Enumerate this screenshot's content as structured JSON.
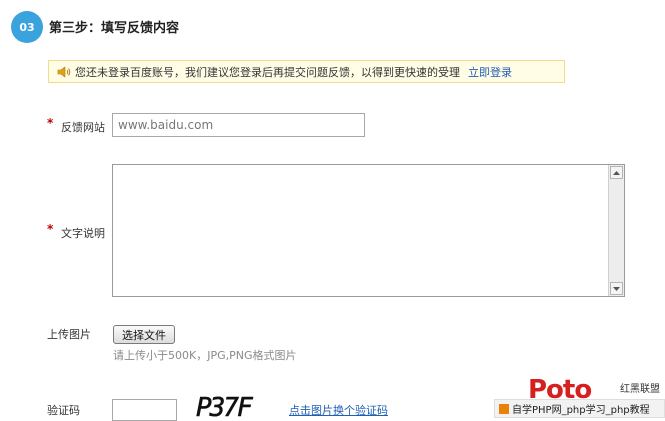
{
  "step": {
    "number": "03",
    "title": "第三步：填写反馈内容"
  },
  "notice": {
    "icon": "speaker-icon",
    "text": "您还未登录百度账号，我们建议您登录后再提交问题反馈，以得到更快速的受理",
    "link": "立即登录"
  },
  "form": {
    "required_mark": "*",
    "site": {
      "label": "反馈网站",
      "value": "www.baidu.com"
    },
    "desc": {
      "label": "文字说明",
      "value": ""
    },
    "upload": {
      "label": "上传图片",
      "button": "选择文件",
      "hint": "请上传小于500K，JPG,PNG格式图片"
    },
    "captcha": {
      "label": "验证码",
      "value": "",
      "image_text": "P37F",
      "refresh_link": "点击图片换个验证码"
    }
  },
  "watermark": {
    "logo_text": "Poto",
    "brand": "红黑联盟",
    "bar_text": "自学PHP网_php学习_php教程"
  },
  "colors": {
    "step_circle": "#3aa3dd",
    "link": "#1f5fb4",
    "required": "#c00000",
    "notice_bg": "#fffde6"
  }
}
